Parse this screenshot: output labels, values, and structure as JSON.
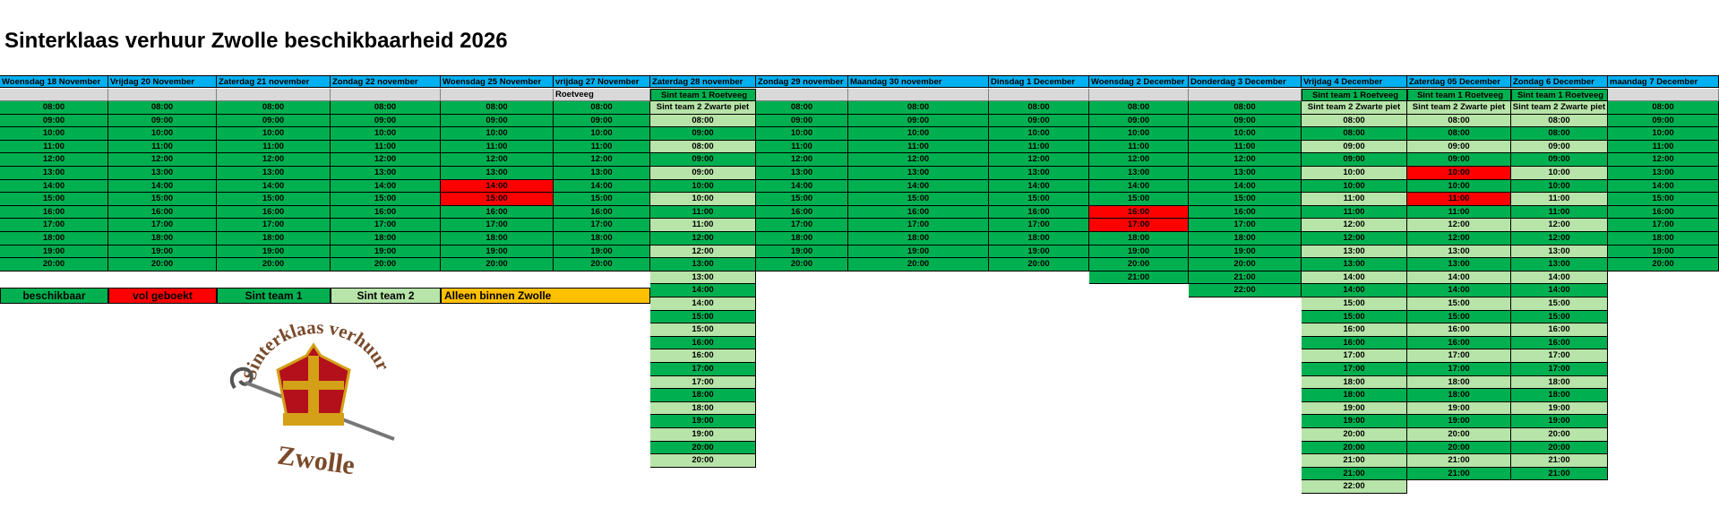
{
  "title": "Sinterklaas verhuur Zwolle beschikbaarheid 2026",
  "colors": {
    "header": "#00b0f0",
    "beschikbaar": "#00b050",
    "volgeboekt": "#ff0000",
    "sint_team_1": "#00b050",
    "sint_team_2": "#b7e4a8",
    "alleen_binnen_zwolle": "#ffc000"
  },
  "days": [
    {
      "header": "Woensdag 18 November",
      "sub": "",
      "slots": [
        [
          "08:00",
          "g"
        ],
        [
          "09:00",
          "g"
        ],
        [
          "10:00",
          "g"
        ],
        [
          "11:00",
          "g"
        ],
        [
          "12:00",
          "g"
        ],
        [
          "13:00",
          "g"
        ],
        [
          "14:00",
          "g"
        ],
        [
          "15:00",
          "g"
        ],
        [
          "16:00",
          "g"
        ],
        [
          "17:00",
          "g"
        ],
        [
          "18:00",
          "g"
        ],
        [
          "19:00",
          "g"
        ],
        [
          "20:00",
          "g"
        ]
      ]
    },
    {
      "header": "Vrijdag 20 November",
      "sub": "",
      "slots": [
        [
          "08:00",
          "g"
        ],
        [
          "09:00",
          "g"
        ],
        [
          "10:00",
          "g"
        ],
        [
          "11:00",
          "g"
        ],
        [
          "12:00",
          "g"
        ],
        [
          "13:00",
          "g"
        ],
        [
          "14:00",
          "g"
        ],
        [
          "15:00",
          "g"
        ],
        [
          "16:00",
          "g"
        ],
        [
          "17:00",
          "g"
        ],
        [
          "18:00",
          "g"
        ],
        [
          "19:00",
          "g"
        ],
        [
          "20:00",
          "g"
        ]
      ]
    },
    {
      "header": "Zaterdag 21 november",
      "sub": "",
      "slots": [
        [
          "08:00",
          "g"
        ],
        [
          "09:00",
          "g"
        ],
        [
          "10:00",
          "g"
        ],
        [
          "11:00",
          "g"
        ],
        [
          "12:00",
          "g"
        ],
        [
          "13:00",
          "g"
        ],
        [
          "14:00",
          "g"
        ],
        [
          "15:00",
          "g"
        ],
        [
          "16:00",
          "g"
        ],
        [
          "17:00",
          "g"
        ],
        [
          "18:00",
          "g"
        ],
        [
          "19:00",
          "g"
        ],
        [
          "20:00",
          "g"
        ]
      ]
    },
    {
      "header": "Zondag 22 november",
      "sub": "",
      "slots": [
        [
          "08:00",
          "g"
        ],
        [
          "09:00",
          "g"
        ],
        [
          "10:00",
          "g"
        ],
        [
          "11:00",
          "g"
        ],
        [
          "12:00",
          "g"
        ],
        [
          "13:00",
          "g"
        ],
        [
          "14:00",
          "g"
        ],
        [
          "15:00",
          "g"
        ],
        [
          "16:00",
          "g"
        ],
        [
          "17:00",
          "g"
        ],
        [
          "18:00",
          "g"
        ],
        [
          "19:00",
          "g"
        ],
        [
          "20:00",
          "g"
        ]
      ]
    },
    {
      "header": "Woensdag 25 November",
      "sub": "",
      "slots": [
        [
          "08:00",
          "g"
        ],
        [
          "09:00",
          "g"
        ],
        [
          "10:00",
          "g"
        ],
        [
          "11:00",
          "g"
        ],
        [
          "12:00",
          "g"
        ],
        [
          "13:00",
          "g"
        ],
        [
          "14:00",
          "r"
        ],
        [
          "15:00",
          "r"
        ],
        [
          "16:00",
          "g"
        ],
        [
          "17:00",
          "g"
        ],
        [
          "18:00",
          "g"
        ],
        [
          "19:00",
          "g"
        ],
        [
          "20:00",
          "g"
        ]
      ]
    },
    {
      "header": "vrijdag 27 November",
      "sub": "Roetveeg",
      "slots": [
        [
          "08:00",
          "g"
        ],
        [
          "09:00",
          "g"
        ],
        [
          "10:00",
          "g"
        ],
        [
          "11:00",
          "g"
        ],
        [
          "12:00",
          "g"
        ],
        [
          "13:00",
          "g"
        ],
        [
          "14:00",
          "g"
        ],
        [
          "15:00",
          "g"
        ],
        [
          "16:00",
          "g"
        ],
        [
          "17:00",
          "g"
        ],
        [
          "18:00",
          "g"
        ],
        [
          "19:00",
          "g"
        ],
        [
          "20:00",
          "g"
        ]
      ]
    },
    {
      "header": "Zaterdag 28 november",
      "sub": "Sint team 1 Roetveeg",
      "team": "Sint team 2 Zwarte piet",
      "slots": [
        [
          "08:00",
          "lg"
        ],
        [
          "09:00",
          "g"
        ],
        [
          "08:00",
          "lg"
        ],
        [
          "09:00",
          "g"
        ],
        [
          "09:00",
          "lg"
        ],
        [
          "10:00",
          "g"
        ],
        [
          "10:00",
          "lg"
        ],
        [
          "11:00",
          "g"
        ],
        [
          "11:00",
          "lg"
        ],
        [
          "12:00",
          "g"
        ],
        [
          "12:00",
          "lg"
        ],
        [
          "13:00",
          "g"
        ],
        [
          "13:00",
          "lg"
        ],
        [
          "14:00",
          "g"
        ],
        [
          "14:00",
          "lg"
        ],
        [
          "15:00",
          "g"
        ],
        [
          "15:00",
          "lg"
        ],
        [
          "16:00",
          "g"
        ],
        [
          "16:00",
          "lg"
        ],
        [
          "17:00",
          "g"
        ],
        [
          "17:00",
          "lg"
        ],
        [
          "18:00",
          "g"
        ],
        [
          "18:00",
          "lg"
        ],
        [
          "19:00",
          "g"
        ],
        [
          "19:00",
          "lg"
        ],
        [
          "20:00",
          "g"
        ],
        [
          "20:00",
          "lg"
        ]
      ]
    },
    {
      "header": "Zondag 29 november",
      "sub": "",
      "slots": [
        [
          "08:00",
          "g"
        ],
        [
          "09:00",
          "g"
        ],
        [
          "10:00",
          "g"
        ],
        [
          "11:00",
          "g"
        ],
        [
          "12:00",
          "g"
        ],
        [
          "13:00",
          "g"
        ],
        [
          "14:00",
          "g"
        ],
        [
          "15:00",
          "g"
        ],
        [
          "16:00",
          "g"
        ],
        [
          "17:00",
          "g"
        ],
        [
          "18:00",
          "g"
        ],
        [
          "19:00",
          "g"
        ],
        [
          "20:00",
          "g"
        ]
      ]
    },
    {
      "header": "Maandag 30 november",
      "sub": "",
      "slots": [
        [
          "08:00",
          "g"
        ],
        [
          "09:00",
          "g"
        ],
        [
          "10:00",
          "g"
        ],
        [
          "11:00",
          "g"
        ],
        [
          "12:00",
          "g"
        ],
        [
          "13:00",
          "g"
        ],
        [
          "14:00",
          "g"
        ],
        [
          "15:00",
          "g"
        ],
        [
          "16:00",
          "g"
        ],
        [
          "17:00",
          "g"
        ],
        [
          "18:00",
          "g"
        ],
        [
          "19:00",
          "g"
        ],
        [
          "20:00",
          "g"
        ]
      ]
    },
    {
      "header": "Dinsdag 1 December",
      "sub": "",
      "slots": [
        [
          "08:00",
          "g"
        ],
        [
          "09:00",
          "g"
        ],
        [
          "10:00",
          "g"
        ],
        [
          "11:00",
          "g"
        ],
        [
          "12:00",
          "g"
        ],
        [
          "13:00",
          "g"
        ],
        [
          "14:00",
          "g"
        ],
        [
          "15:00",
          "g"
        ],
        [
          "16:00",
          "g"
        ],
        [
          "17:00",
          "g"
        ],
        [
          "18:00",
          "g"
        ],
        [
          "19:00",
          "g"
        ],
        [
          "20:00",
          "g"
        ]
      ]
    },
    {
      "header": "Woensdag 2 December",
      "sub": "",
      "slots": [
        [
          "08:00",
          "g"
        ],
        [
          "09:00",
          "g"
        ],
        [
          "10:00",
          "g"
        ],
        [
          "11:00",
          "g"
        ],
        [
          "12:00",
          "g"
        ],
        [
          "13:00",
          "g"
        ],
        [
          "14:00",
          "g"
        ],
        [
          "15:00",
          "g"
        ],
        [
          "16:00",
          "r"
        ],
        [
          "17:00",
          "r"
        ],
        [
          "18:00",
          "g"
        ],
        [
          "19:00",
          "g"
        ],
        [
          "20:00",
          "g"
        ],
        [
          "21:00",
          "g"
        ]
      ]
    },
    {
      "header": "Donderdag 3 December",
      "sub": "",
      "slots": [
        [
          "08:00",
          "g"
        ],
        [
          "09:00",
          "g"
        ],
        [
          "10:00",
          "g"
        ],
        [
          "11:00",
          "g"
        ],
        [
          "12:00",
          "g"
        ],
        [
          "13:00",
          "g"
        ],
        [
          "14:00",
          "g"
        ],
        [
          "15:00",
          "g"
        ],
        [
          "16:00",
          "g"
        ],
        [
          "17:00",
          "g"
        ],
        [
          "18:00",
          "g"
        ],
        [
          "19:00",
          "g"
        ],
        [
          "20:00",
          "g"
        ],
        [
          "21:00",
          "g"
        ],
        [
          "22:00",
          "g"
        ]
      ]
    },
    {
      "header": "Vrijdag 4 December",
      "sub": "Sint team 1 Roetveeg",
      "team": "Sint team 2 Zwarte piet",
      "slots": [
        [
          "08:00",
          "lg"
        ],
        [
          "08:00",
          "g"
        ],
        [
          "09:00",
          "lg"
        ],
        [
          "09:00",
          "g"
        ],
        [
          "10:00",
          "lg"
        ],
        [
          "10:00",
          "g"
        ],
        [
          "11:00",
          "lg"
        ],
        [
          "11:00",
          "g"
        ],
        [
          "12:00",
          "lg"
        ],
        [
          "12:00",
          "g"
        ],
        [
          "13:00",
          "lg"
        ],
        [
          "13:00",
          "g"
        ],
        [
          "14:00",
          "lg"
        ],
        [
          "14:00",
          "g"
        ],
        [
          "15:00",
          "lg"
        ],
        [
          "15:00",
          "g"
        ],
        [
          "16:00",
          "lg"
        ],
        [
          "16:00",
          "g"
        ],
        [
          "17:00",
          "lg"
        ],
        [
          "17:00",
          "g"
        ],
        [
          "18:00",
          "lg"
        ],
        [
          "18:00",
          "g"
        ],
        [
          "19:00",
          "lg"
        ],
        [
          "19:00",
          "g"
        ],
        [
          "20:00",
          "lg"
        ],
        [
          "20:00",
          "g"
        ],
        [
          "21:00",
          "lg"
        ],
        [
          "21:00",
          "g"
        ],
        [
          "22:00",
          "lg"
        ]
      ]
    },
    {
      "header": "Zaterdag 05 December",
      "sub": "Sint team 1 Roetveeg",
      "team": "Sint team 2 Zwarte piet",
      "slots": [
        [
          "08:00",
          "lg"
        ],
        [
          "08:00",
          "g"
        ],
        [
          "09:00",
          "lg"
        ],
        [
          "09:00",
          "g"
        ],
        [
          "10:00",
          "r"
        ],
        [
          "10:00",
          "g"
        ],
        [
          "11:00",
          "r"
        ],
        [
          "11:00",
          "g"
        ],
        [
          "12:00",
          "lg"
        ],
        [
          "12:00",
          "g"
        ],
        [
          "13:00",
          "lg"
        ],
        [
          "13:00",
          "g"
        ],
        [
          "14:00",
          "lg"
        ],
        [
          "14:00",
          "g"
        ],
        [
          "15:00",
          "lg"
        ],
        [
          "15:00",
          "g"
        ],
        [
          "16:00",
          "lg"
        ],
        [
          "16:00",
          "g"
        ],
        [
          "17:00",
          "lg"
        ],
        [
          "17:00",
          "g"
        ],
        [
          "18:00",
          "lg"
        ],
        [
          "18:00",
          "g"
        ],
        [
          "19:00",
          "lg"
        ],
        [
          "19:00",
          "g"
        ],
        [
          "20:00",
          "lg"
        ],
        [
          "20:00",
          "g"
        ],
        [
          "21:00",
          "lg"
        ],
        [
          "21:00",
          "g"
        ]
      ]
    },
    {
      "header": "Zondag 6 December",
      "sub": "Sint team 1 Roetveeg",
      "team": "Sint team 2 Zwarte piet",
      "slots": [
        [
          "08:00",
          "lg"
        ],
        [
          "08:00",
          "g"
        ],
        [
          "09:00",
          "lg"
        ],
        [
          "09:00",
          "g"
        ],
        [
          "10:00",
          "lg"
        ],
        [
          "10:00",
          "g"
        ],
        [
          "11:00",
          "lg"
        ],
        [
          "11:00",
          "g"
        ],
        [
          "12:00",
          "lg"
        ],
        [
          "12:00",
          "g"
        ],
        [
          "13:00",
          "lg"
        ],
        [
          "13:00",
          "g"
        ],
        [
          "14:00",
          "lg"
        ],
        [
          "14:00",
          "g"
        ],
        [
          "15:00",
          "lg"
        ],
        [
          "15:00",
          "g"
        ],
        [
          "16:00",
          "lg"
        ],
        [
          "16:00",
          "g"
        ],
        [
          "17:00",
          "lg"
        ],
        [
          "17:00",
          "g"
        ],
        [
          "18:00",
          "lg"
        ],
        [
          "18:00",
          "g"
        ],
        [
          "19:00",
          "lg"
        ],
        [
          "19:00",
          "g"
        ],
        [
          "20:00",
          "lg"
        ],
        [
          "20:00",
          "g"
        ],
        [
          "21:00",
          "lg"
        ],
        [
          "21:00",
          "g"
        ]
      ]
    },
    {
      "header": "maandag 7 December",
      "sub": "",
      "slots": [
        [
          "08:00",
          "g"
        ],
        [
          "09:00",
          "g"
        ],
        [
          "10:00",
          "g"
        ],
        [
          "11:00",
          "g"
        ],
        [
          "12:00",
          "g"
        ],
        [
          "13:00",
          "g"
        ],
        [
          "14:00",
          "g"
        ],
        [
          "15:00",
          "g"
        ],
        [
          "16:00",
          "g"
        ],
        [
          "17:00",
          "g"
        ],
        [
          "18:00",
          "g"
        ],
        [
          "19:00",
          "g"
        ],
        [
          "20:00",
          "g"
        ]
      ]
    }
  ],
  "legend": {
    "beschikbaar": "beschikbaar",
    "volgeboekt": "vol geboekt",
    "sint_team_1": "Sint team 1",
    "sint_team_2": "Sint team 2",
    "alleen_binnen_zwolle": "Alleen binnen Zwolle"
  },
  "logo": {
    "top_text": "Sinterklaas verhuur",
    "bottom_text": "Zwolle"
  }
}
